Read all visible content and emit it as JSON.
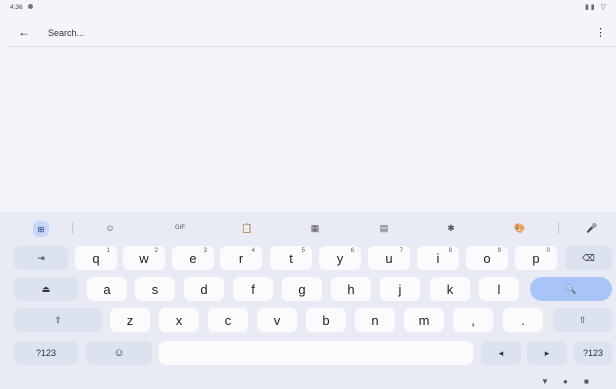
{
  "status": {
    "time": "4:36",
    "right_icons": "▮▮ ▽"
  },
  "search": {
    "back": "←",
    "query": "Search...",
    "more": "⋮"
  },
  "toolbar": {
    "apps": "⊞",
    "icons": [
      {
        "name": "sticker-icon",
        "glyph": "☺"
      },
      {
        "name": "gif-icon",
        "glyph": "GIF"
      },
      {
        "name": "clipboard-icon",
        "glyph": "📋"
      },
      {
        "name": "translate-icon",
        "glyph": "▦"
      },
      {
        "name": "floating-keyboard-icon",
        "glyph": "▤"
      },
      {
        "name": "settings-icon",
        "glyph": "✱"
      },
      {
        "name": "theme-icon",
        "glyph": "🎨"
      },
      {
        "name": "mic-icon",
        "glyph": "🎤"
      }
    ]
  },
  "keys": {
    "tab": "⇥",
    "row1": [
      {
        "label": "q",
        "sup": "1"
      },
      {
        "label": "w",
        "sup": "2"
      },
      {
        "label": "e",
        "sup": "3"
      },
      {
        "label": "r",
        "sup": "4"
      },
      {
        "label": "t",
        "sup": "5"
      },
      {
        "label": "y",
        "sup": "6"
      },
      {
        "label": "u",
        "sup": "7"
      },
      {
        "label": "i",
        "sup": "8"
      },
      {
        "label": "o",
        "sup": "9"
      },
      {
        "label": "p",
        "sup": "0"
      }
    ],
    "backspace": "⌫",
    "caps": "⏏",
    "row2": [
      "a",
      "s",
      "d",
      "f",
      "g",
      "h",
      "j",
      "k",
      "l"
    ],
    "search": "🔍",
    "shift_left": "⇧",
    "row3": [
      "z",
      "x",
      "c",
      "v",
      "b",
      "n",
      "m",
      ",",
      "."
    ],
    "shift_right": "⇧",
    "symbols": "?123",
    "emoji": "☺",
    "space": "",
    "left": "◂",
    "right": "▸",
    "symbols_right": "?123"
  },
  "nav": {
    "back": "▼",
    "home": "●",
    "recents": "■"
  }
}
